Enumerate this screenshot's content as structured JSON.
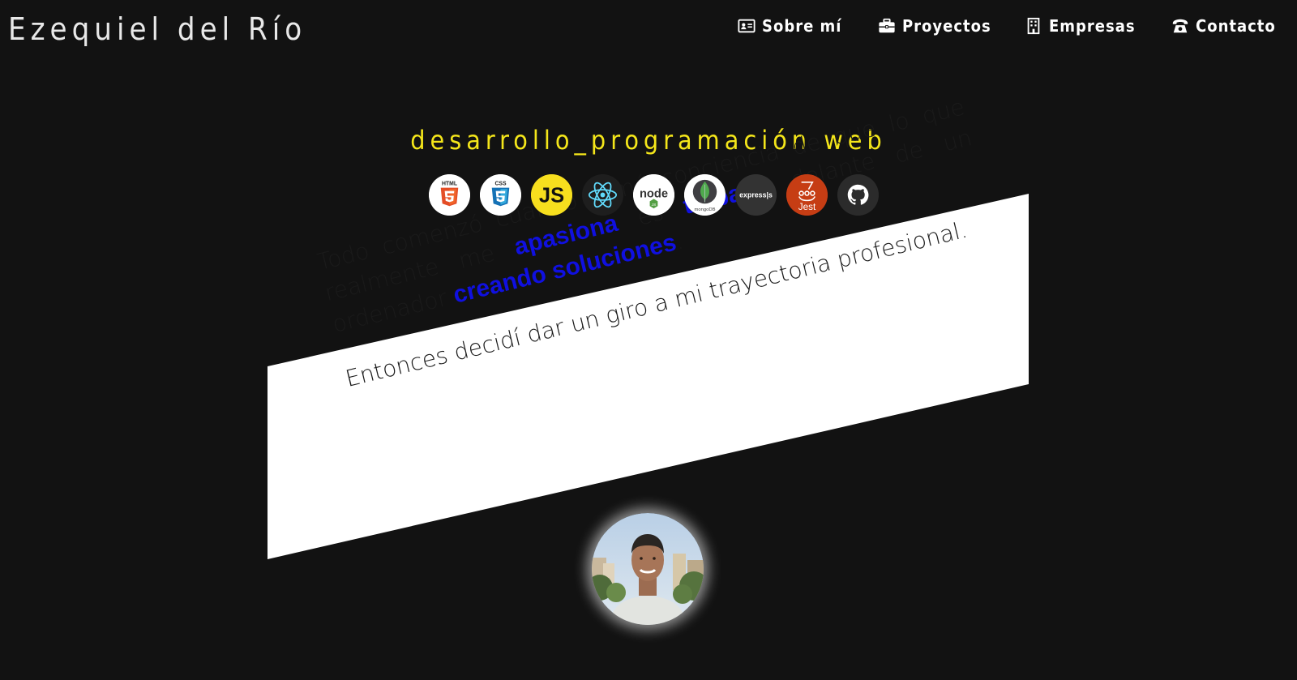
{
  "header": {
    "brand": "Ezequiel del Río"
  },
  "nav": {
    "items": [
      {
        "label": "Sobre mí",
        "icon": "id-card-icon"
      },
      {
        "label": "Proyectos",
        "icon": "briefcase-icon"
      },
      {
        "label": "Empresas",
        "icon": "building-icon"
      },
      {
        "label": "Contacto",
        "icon": "telephone-icon"
      }
    ]
  },
  "hero": {
    "subtitle": "desarrollo_programación web",
    "technologies": [
      {
        "name": "HTML5",
        "icon": "html5-icon",
        "label": "HTML",
        "color": "#e44d26"
      },
      {
        "name": "CSS3",
        "icon": "css3-icon",
        "label": "CSS",
        "color": "#1572b6"
      },
      {
        "name": "JavaScript",
        "icon": "javascript-icon",
        "label": "JS",
        "color": "#f7df1e"
      },
      {
        "name": "React",
        "icon": "react-icon",
        "color": "#61dafb"
      },
      {
        "name": "Node.js",
        "icon": "nodejs-icon",
        "label": "node",
        "color": "#539e43"
      },
      {
        "name": "MongoDB",
        "icon": "mongodb-icon",
        "label": "mongoDB",
        "color": "#4fa94d"
      },
      {
        "name": "Express",
        "icon": "express-icon",
        "label": "express|s",
        "color": "#333333"
      },
      {
        "name": "Jest",
        "icon": "jest-icon",
        "label": "Jest",
        "color": "#c63d14"
      },
      {
        "name": "GitHub",
        "icon": "github-icon",
        "color": "#2b2b2b"
      }
    ]
  },
  "about": {
    "p1_start": "Todo comenzó cuando tomé conciencia de que lo que realmente me ",
    "p1_hl1": "apasiona",
    "p1_mid": " es ",
    "p1_hl2": "trabajar",
    "p1_mid2": " delante de un ordenador ",
    "p1_hl3": "creando soluciones",
    "p1_end": ".",
    "p2": "Entonces decidí dar un giro a mi trayectoria profesional."
  },
  "colors": {
    "background": "#121212",
    "accent_yellow": "#f4e61a",
    "highlight_blue": "#1010e0",
    "panel": "#ffffff"
  }
}
